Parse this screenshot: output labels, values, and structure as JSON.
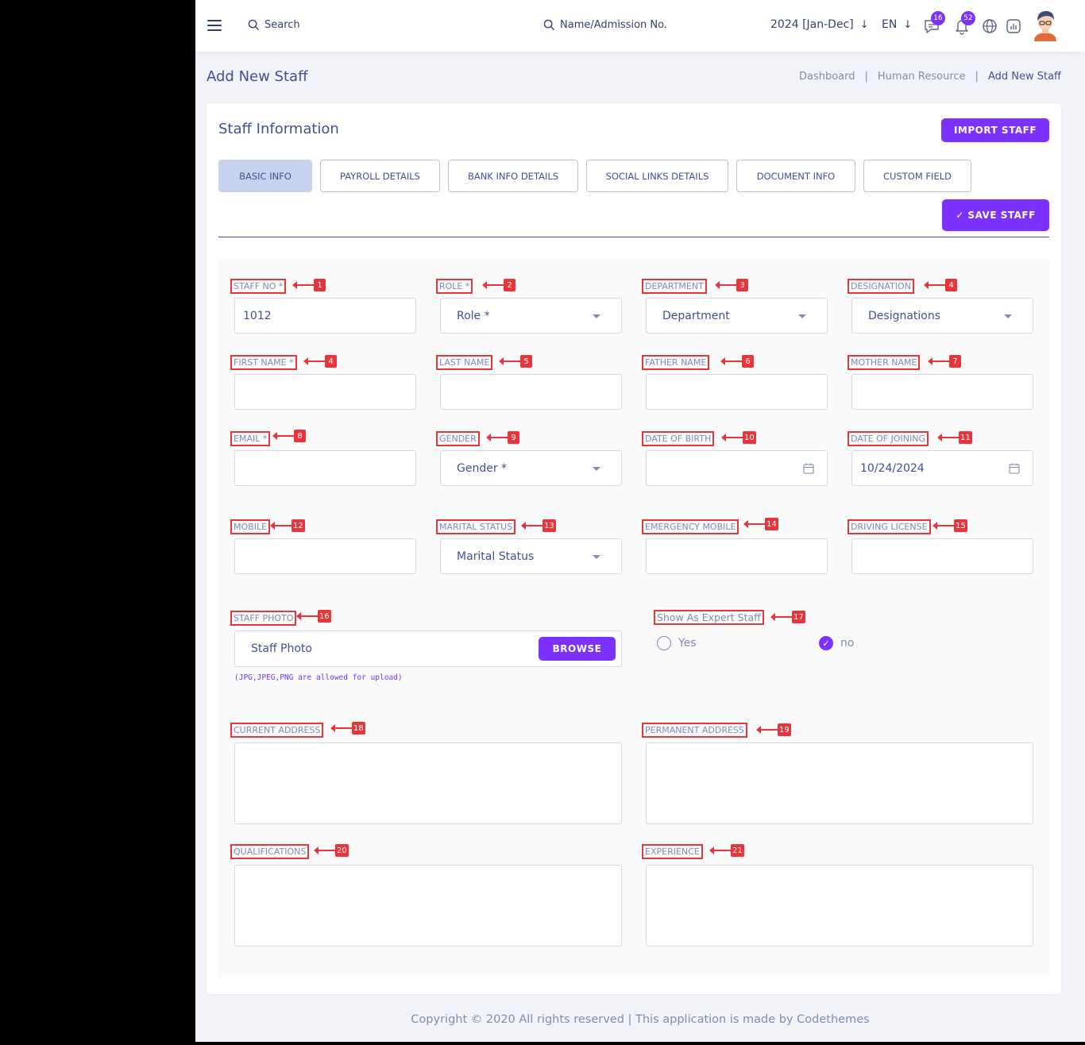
{
  "topbar": {
    "search_label": "Search",
    "student_search_label": "Name/Admission No.",
    "academic_year": "2024 [Jan-Dec]",
    "language": "EN",
    "messages_count": "16",
    "notifications_count": "52"
  },
  "header": {
    "title": "Add New Staff",
    "breadcrumb": [
      "Dashboard",
      "Human Resource",
      "Add New Staff"
    ]
  },
  "card": {
    "title": "Staff Information",
    "import_label": "IMPORT STAFF",
    "save_label": "✓ SAVE STAFF",
    "tabs": [
      "BASIC INFO",
      "PAYROLL DETAILS",
      "BANK INFO DETAILS",
      "SOCIAL LINKS DETAILS",
      "DOCUMENT INFO",
      "CUSTOM FIELD"
    ],
    "active_tab": "BASIC INFO"
  },
  "labels": {
    "staff_no": "STAFF NO *",
    "role": "ROLE *",
    "department": "DEPARTMENT",
    "designation": "DESIGNATION",
    "first_name": "FIRST NAME *",
    "last_name": "LAST NAME",
    "father_name": "FATHER NAME",
    "mother_name": "MOTHER NAME",
    "email": "EMAIL *",
    "gender": "GENDER",
    "dob": "DATE OF BIRTH",
    "doj": "DATE OF JOINING",
    "mobile": "MOBILE",
    "marital": "MARITAL STATUS",
    "emergency": "EMERGENCY MOBILE",
    "license": "DRIVING LICENSE",
    "photo": "STAFF PHOTO",
    "expert": "Show As Expert Staff",
    "current_address": "CURRENT ADDRESS",
    "permanent_address": "PERMANENT ADDRESS",
    "qualifications": "QUALIFICATIONS",
    "experience": "EXPERIENCE"
  },
  "markers": [
    "1",
    "2",
    "3",
    "4",
    "4",
    "5",
    "6",
    "7",
    "8",
    "9",
    "10",
    "11",
    "12",
    "13",
    "14",
    "15",
    "16",
    "17",
    "18",
    "19",
    "20",
    "21"
  ],
  "values": {
    "staff_no": "1012",
    "role": "Role *",
    "department": "Department",
    "designation": "Designations",
    "gender": "Gender *",
    "doj": "10/24/2024",
    "marital": "Marital Status",
    "photo_placeholder": "Staff Photo",
    "browse_label": "BROWSE",
    "photo_hint": "(JPG,JPEG,PNG are allowed for upload)",
    "expert_yes": "Yes",
    "expert_no": "no",
    "expert_selected": "no"
  },
  "footer": "Copyright © 2020 All rights reserved | This application is made by Codethemes",
  "colors": {
    "accent": "#7c32ff",
    "marker": "#e8343b",
    "text": "#415094",
    "muted": "#828bb2"
  }
}
